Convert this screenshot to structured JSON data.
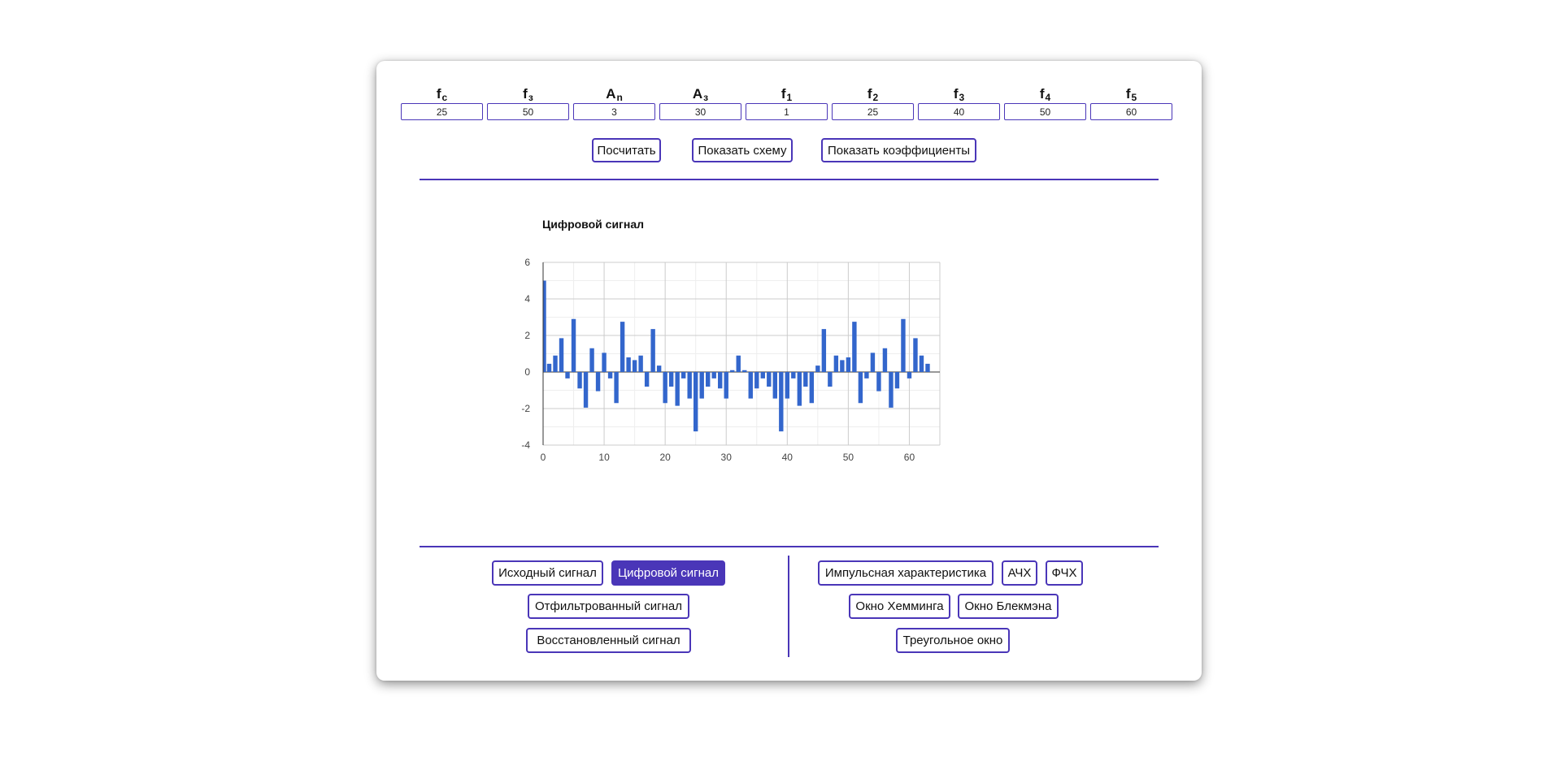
{
  "params": [
    {
      "base": "f",
      "sub": "c",
      "value": "25"
    },
    {
      "base": "f",
      "sub": "з",
      "value": "50"
    },
    {
      "base": "A",
      "sub": "n",
      "value": "3"
    },
    {
      "base": "A",
      "sub": "з",
      "value": "30"
    },
    {
      "base": "f",
      "sub": "1",
      "value": "1"
    },
    {
      "base": "f",
      "sub": "2",
      "value": "25"
    },
    {
      "base": "f",
      "sub": "3",
      "value": "40"
    },
    {
      "base": "f",
      "sub": "4",
      "value": "50"
    },
    {
      "base": "f",
      "sub": "5",
      "value": "60"
    }
  ],
  "actions": {
    "calculate": "Посчитать",
    "show_scheme": "Показать схему",
    "show_coefficients": "Показать коэффициенты"
  },
  "signal_buttons": {
    "source": "Исходный сигнал",
    "digital": "Цифровой сигнал",
    "filtered": "Отфильтрованный сигнал",
    "restored": "Восстановленный сигнал"
  },
  "filter_buttons": {
    "impulse": "Импульсная характеристика",
    "afc": "АЧХ",
    "pfc": "ФЧХ",
    "hamming": "Окно Хемминга",
    "blackman": "Окно Блекмэна",
    "triangular": "Треугольное окно"
  },
  "colors": {
    "accent": "#4a36b8",
    "bar": "#3366cc"
  },
  "chart_data": {
    "type": "bar",
    "title": "Цифровой сигнал",
    "x": [
      0,
      1,
      2,
      3,
      4,
      5,
      6,
      7,
      8,
      9,
      10,
      11,
      12,
      13,
      14,
      15,
      16,
      17,
      18,
      19,
      20,
      21,
      22,
      23,
      24,
      25,
      26,
      27,
      28,
      29,
      30,
      31,
      32,
      33,
      34,
      35,
      36,
      37,
      38,
      39,
      40,
      41,
      42,
      43,
      44,
      45,
      46,
      47,
      48,
      49,
      50,
      51,
      52,
      53,
      54,
      55,
      56,
      57,
      58,
      59,
      60,
      61,
      62,
      63
    ],
    "values": [
      5.0,
      0.45,
      0.9,
      1.85,
      -0.35,
      2.9,
      -0.9,
      -1.95,
      1.3,
      -1.05,
      1.05,
      -0.35,
      -1.7,
      2.75,
      0.8,
      0.65,
      0.9,
      -0.8,
      2.35,
      0.35,
      -1.7,
      -0.8,
      -1.85,
      -0.35,
      -1.45,
      -3.25,
      -1.45,
      -0.8,
      -0.35,
      -0.9,
      -1.45,
      0.1,
      0.9,
      0.1,
      -1.45,
      -0.9,
      -0.35,
      -0.8,
      -1.45,
      -3.25,
      -1.45,
      -0.35,
      -1.85,
      -0.8,
      -1.7,
      0.35,
      2.35,
      -0.8,
      0.9,
      0.65,
      0.8,
      2.75,
      -1.7,
      -0.35,
      1.05,
      -1.05,
      1.3,
      -1.95,
      -0.9,
      2.9,
      -0.35,
      1.85,
      0.9,
      0.45
    ],
    "xlim": [
      0,
      65
    ],
    "ylim": [
      -4,
      6
    ],
    "x_ticks": [
      0,
      10,
      20,
      30,
      40,
      50,
      60
    ],
    "y_ticks": [
      -4,
      -2,
      0,
      2,
      4,
      6
    ],
    "grid": true
  }
}
